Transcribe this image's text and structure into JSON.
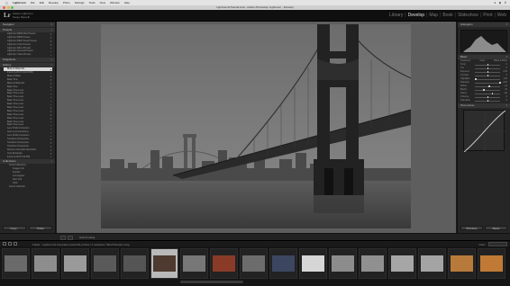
{
  "menubar": {
    "app_name": "Lightroom",
    "items": [
      "File",
      "Edit",
      "Develop",
      "Photo",
      "Settings",
      "Tools",
      "View",
      "Window",
      "Help"
    ]
  },
  "window": {
    "title": "Lightroom4Tutorial.lrcat - Adobe Photoshop Lightroom - Develop"
  },
  "identity": {
    "logo": "Lr",
    "line1": "Adobe Lightroom",
    "line2": "Serge Ramelli"
  },
  "modules": {
    "items": [
      "Library",
      "Develop",
      "Map",
      "Book",
      "Slideshow",
      "Print",
      "Web"
    ],
    "active": "Develop"
  },
  "left_panel": {
    "navigator": "Navigator",
    "presets_head": "Presets",
    "user_presets": [
      "Lightroom B&W Filter Presets",
      "Lightroom B&W Presets",
      "Lightroom B&W Toned Presets",
      "Lightroom Color Presets",
      "Lightroom Effect Presets",
      "Lightroom General Presets",
      "Lightroom Video Presets"
    ],
    "snapshots_head": "Snapshots",
    "history_head": "History",
    "history": [
      "Black & White Mix",
      "Import (1/2/13 5:21:00 PM)",
      "Black & White",
      "Basic Tone",
      "Black & White Mix",
      "Basic Tone",
      "Basic Tone Level",
      "Basic Tone Level",
      "Basic Tone Level",
      "Basic Tone Level",
      "Basic Tone Level",
      "Basic Tone Level",
      "Basic Tone Level",
      "Basic Tone Level",
      "Basic Tone Level",
      "Basic Tone Level",
      "Basic Tone Level",
      "Lens Profile Correction",
      "Auto Lens Corrections",
      "Lens Profile Correction",
      "Transform Perspective",
      "Transform Perspective",
      "Transform Perspective",
      "Remove Chromatic Aberration",
      "Crop Rectangle",
      "Import (1/2/13 5:20 PM)"
    ],
    "selected_index": 0,
    "collections_head": "Collections",
    "collections": [
      "Smart Collections",
      "Images Coll",
      "Favorite",
      "Los Angeles",
      "New York",
      "Paris",
      "Import Collection"
    ],
    "copy_button": "Copy...",
    "paste_button": "Paste"
  },
  "toolbar": {
    "softproof": "Soft Proofing"
  },
  "right_panel": {
    "histogram_head": "Histogram",
    "basic_head": "Basic",
    "treatment_label": "Treatment:",
    "treatment_color": "Color",
    "treatment_bw": "Black & White",
    "sliders": [
      {
        "label": "Temp",
        "value": "0",
        "level": 0.5
      },
      {
        "label": "Tint",
        "value": "0",
        "level": 0.5
      },
      {
        "label": "Exposure",
        "value": "0.00",
        "level": 0.5
      },
      {
        "label": "Contrast",
        "value": "0",
        "level": 0.5
      },
      {
        "label": "Highlights",
        "value": "-100",
        "level": 0.0
      },
      {
        "label": "Shadows",
        "value": "+100",
        "level": 1.0
      },
      {
        "label": "Whites",
        "value": "+11",
        "level": 0.56
      },
      {
        "label": "Blacks",
        "value": "-32",
        "level": 0.34
      },
      {
        "label": "Clarity",
        "value": "+40",
        "level": 0.7
      },
      {
        "label": "Vibrance",
        "value": "0",
        "level": 0.5
      },
      {
        "label": "Saturation",
        "value": "0",
        "level": 0.5
      }
    ],
    "tone_curve_head": "Tone Curve",
    "previous_button": "Previous",
    "reset_button": "Reset"
  },
  "filmstrip": {
    "path": "Folder : Lightroom4 Complete tutorial",
    "count_text": "61 photos / 1 selected / SR-0Tutorial-1.dng",
    "filter_label": "Filter :",
    "thumbs": [
      {
        "tone": "#6a6a6a"
      },
      {
        "tone": "#8d8d8d"
      },
      {
        "tone": "#9a9a9a"
      },
      {
        "tone": "#5a5a5a"
      },
      {
        "tone": "#555555"
      },
      {
        "tone": "#4e3a2f"
      },
      {
        "tone": "#777777"
      },
      {
        "tone": "#8a3b28"
      },
      {
        "tone": "#6c6c6c"
      },
      {
        "tone": "#3c4660"
      },
      {
        "tone": "#d6d6d6"
      },
      {
        "tone": "#8c8c8c"
      },
      {
        "tone": "#909090"
      },
      {
        "tone": "#a6a6a6"
      },
      {
        "tone": "#a4a4a4"
      },
      {
        "tone": "#b87a3a"
      },
      {
        "tone": "#c07a35"
      }
    ],
    "active_index": 5
  }
}
